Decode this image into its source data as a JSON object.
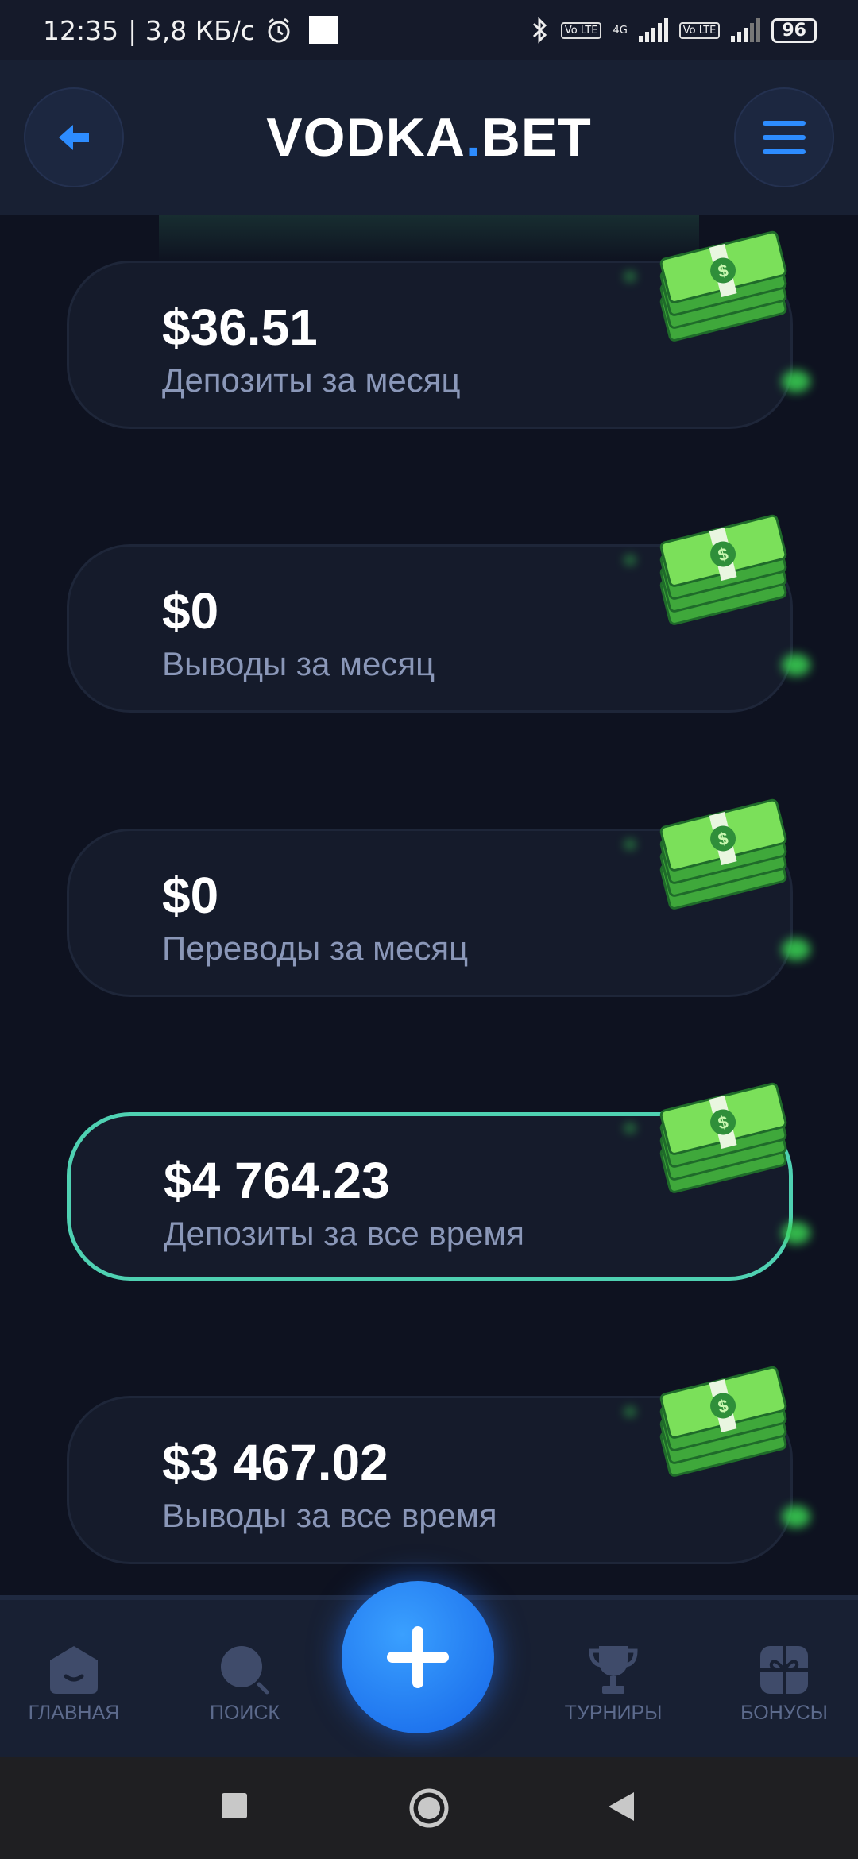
{
  "status_bar": {
    "time": "12:35",
    "network_speed": "| 3,8 КБ/с",
    "network_type": "4G",
    "volte_label": "Vo LTE",
    "battery": "96"
  },
  "header": {
    "logo_left": "VO",
    "logo_mid": "DKA",
    "logo_dot": ".",
    "logo_right": "BET",
    "back_icon": "arrow-left-icon",
    "menu_icon": "hamburger-icon"
  },
  "stats": [
    {
      "amount": "$36.51",
      "label": "Депозиты за месяц"
    },
    {
      "amount": "$0",
      "label": "Выводы за месяц"
    },
    {
      "amount": "$0",
      "label": "Переводы за месяц"
    },
    {
      "amount": "$4 764.23",
      "label": "Депозиты за все время"
    },
    {
      "amount": "$3 467.02",
      "label": "Выводы за все время"
    }
  ],
  "bottom_nav": {
    "items": [
      {
        "label": "ГЛАВНАЯ",
        "icon": "home-icon"
      },
      {
        "label": "ПОИСК",
        "icon": "search-icon"
      },
      {
        "label": "ТУРНИРЫ",
        "icon": "trophy-icon"
      },
      {
        "label": "БОНУСЫ",
        "icon": "gift-icon"
      }
    ],
    "fab_icon": "plus-icon"
  },
  "colors": {
    "accent": "#2d8cff",
    "active_border": "#4fd1b2",
    "background": "#0e1220",
    "card": "#151b2b",
    "muted_text": "#8a97b8"
  }
}
